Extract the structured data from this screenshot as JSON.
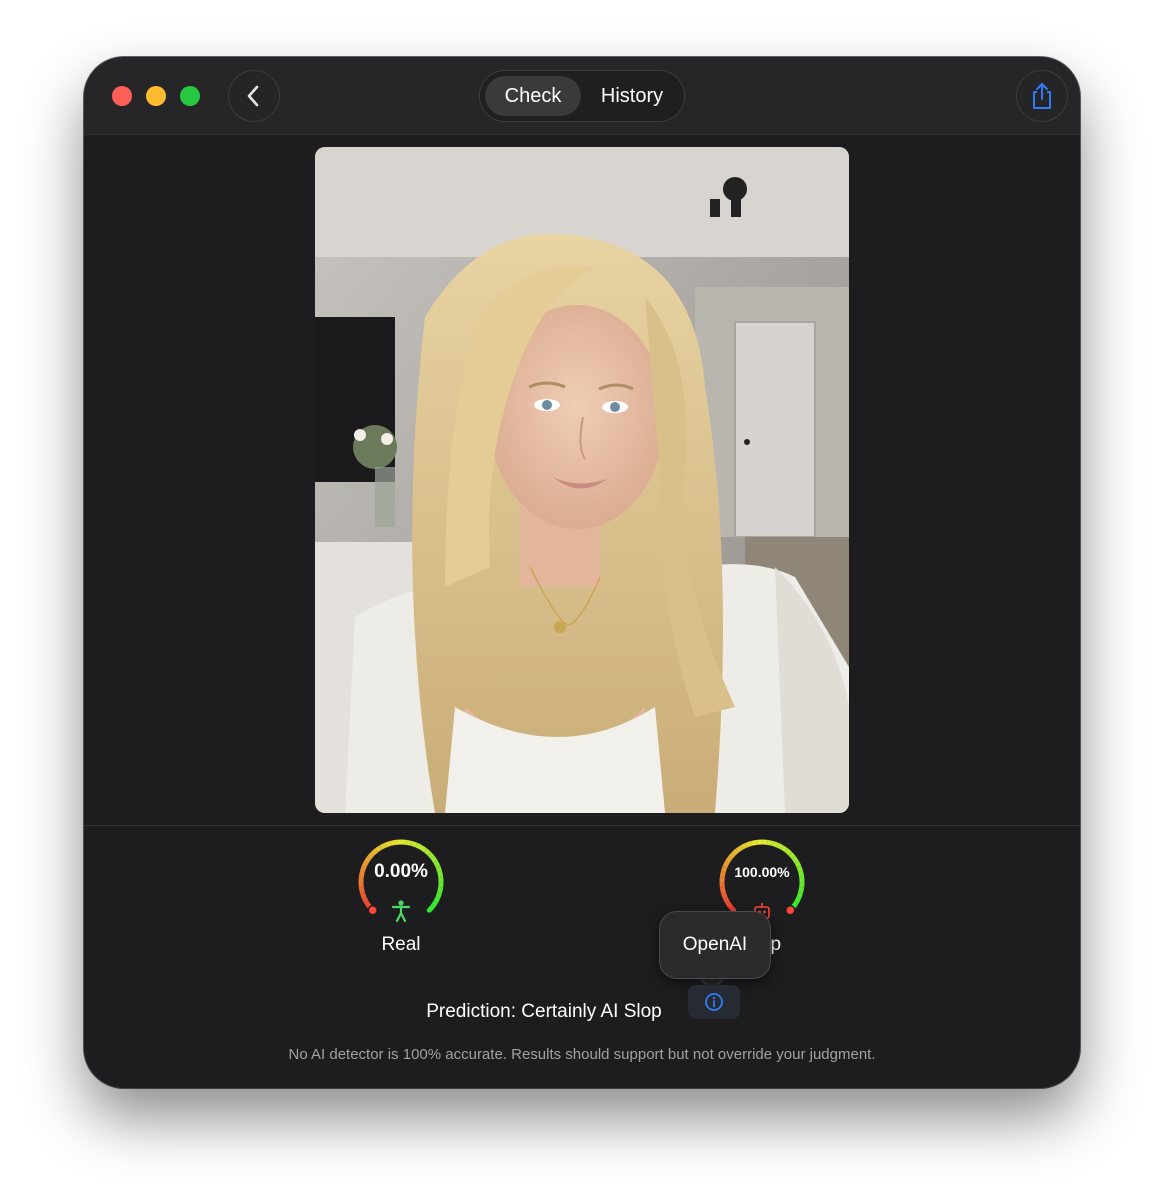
{
  "window": {
    "controls": [
      "close",
      "minimize",
      "zoom"
    ]
  },
  "toolbar": {
    "back_icon": "chevron-left-icon",
    "tabs": [
      {
        "label": "Check",
        "selected": true
      },
      {
        "label": "History",
        "selected": false
      }
    ],
    "share_icon": "share-icon"
  },
  "results": {
    "real": {
      "value": "0.00%",
      "label": "Real",
      "icon": "person-icon",
      "fraction": 0.0
    },
    "slop": {
      "value": "100.00%",
      "label": "Slop",
      "icon": "robot-icon",
      "fraction": 1.0
    },
    "tooltip": "OpenAI",
    "info_icon": "info-icon",
    "prediction": "Prediction: Certainly AI Slop",
    "disclaimer": "No AI detector is 100% accurate. Results should support but not override your judgment."
  },
  "colors": {
    "window_bg": "#1d1d1f",
    "accent_blue": "#2f7cf6",
    "gauge_green": "#4cd964",
    "gauge_red": "#ff453a"
  }
}
